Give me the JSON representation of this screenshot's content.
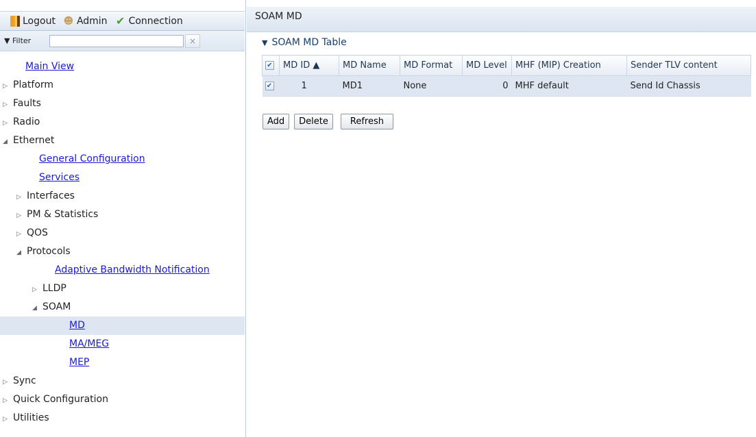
{
  "topbar": {
    "logout_label": "Logout",
    "admin_label": "Admin",
    "connection_label": "Connection"
  },
  "filter": {
    "label": "▼ Filter",
    "value": "",
    "clear": "×"
  },
  "tree": {
    "items": [
      {
        "label": "Main View"
      },
      {
        "label": "Platform"
      },
      {
        "label": "Faults"
      },
      {
        "label": "Radio"
      },
      {
        "label": "Ethernet"
      },
      {
        "label": "General Configuration"
      },
      {
        "label": "Services"
      },
      {
        "label": "Interfaces"
      },
      {
        "label": "PM & Statistics"
      },
      {
        "label": "QOS"
      },
      {
        "label": "Protocols"
      },
      {
        "label": "Adaptive Bandwidth Notification"
      },
      {
        "label": "LLDP"
      },
      {
        "label": "SOAM"
      },
      {
        "label": "MD"
      },
      {
        "label": "MA/MEG"
      },
      {
        "label": "MEP"
      },
      {
        "label": "Sync"
      },
      {
        "label": "Quick Configuration"
      },
      {
        "label": "Utilities"
      }
    ]
  },
  "content": {
    "header": "SOAM MD",
    "section_title": "SOAM MD Table",
    "table": {
      "columns": [
        "MD ID ▲",
        "MD Name",
        "MD Format",
        "MD Level",
        "MHF (MIP) Creation",
        "Sender TLV content"
      ],
      "rows": [
        {
          "md_id": "1",
          "md_name": "MD1",
          "md_format": "None",
          "md_level": "0",
          "mhf_creation": "MHF default",
          "sender_tlv": "Send Id Chassis",
          "checked": true
        }
      ]
    },
    "buttons": {
      "add": "Add",
      "delete": "Delete",
      "refresh": "Refresh"
    }
  },
  "colors": {
    "link": "#1a1ad8",
    "selected_row": "#dde6f1",
    "header_bg": "#dbe4ef"
  }
}
